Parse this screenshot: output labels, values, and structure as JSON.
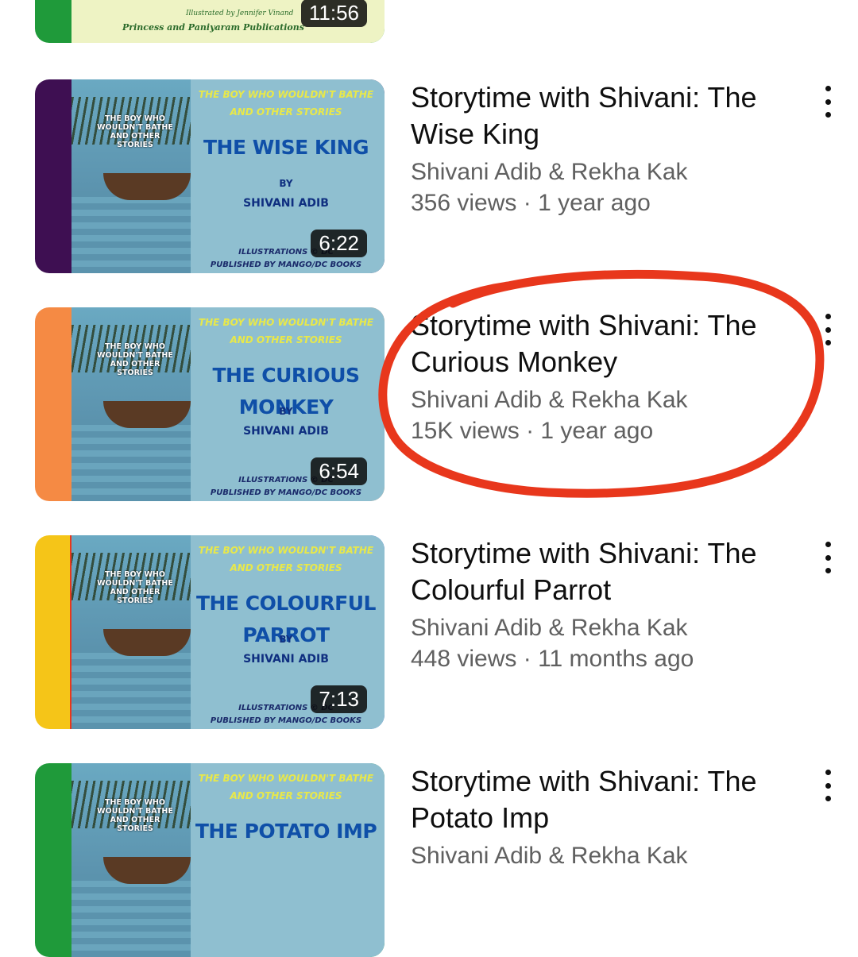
{
  "top_partial": {
    "credit_small": "Illustrated by Jennifer Vinand",
    "publisher": "Princess and Paniyaram Publications",
    "duration": "11:56"
  },
  "videos": [
    {
      "title": "Storytime with Shivani: The Wise King",
      "channel": "Shivani Adib & Rekha Kak",
      "meta": "356 views · 1 year ago",
      "duration": "6:22",
      "thumb": {
        "series": "THE BOY WHO WOULDN'T BATHE AND OTHER STORIES",
        "mini_title": "THE BOY WHO WOULDN'T BATHE AND OTHER STORIES",
        "story": "THE WISE KING",
        "by": "BY",
        "author": "SHIVANI ADIB",
        "illustrations": "ILLUSTRATIONS © DC",
        "published": "PUBLISHED BY MANGO/DC BOOKS",
        "bg": "#3e0f52"
      }
    },
    {
      "title": "Storytime with Shivani: The Curious Monkey",
      "channel": "Shivani Adib & Rekha Kak",
      "meta": "15K views · 1 year ago",
      "duration": "6:54",
      "thumb": {
        "series": "THE BOY WHO WOULDN'T BATHE AND OTHER STORIES",
        "mini_title": "THE BOY WHO WOULDN'T BATHE AND OTHER STORIES",
        "story": "THE CURIOUS MONKEY",
        "by": "BY",
        "author": "SHIVANI ADIB",
        "illustrations": "ILLUSTRATIONS © DC",
        "published": "PUBLISHED BY MANGO/DC BOOKS",
        "bg": "#f58a44"
      }
    },
    {
      "title": "Storytime with Shivani: The Colourful Parrot",
      "channel": "Shivani Adib & Rekha Kak",
      "meta": "448 views · 11 months ago",
      "duration": "7:13",
      "thumb": {
        "series": "THE BOY WHO WOULDN'T BATHE AND OTHER STORIES",
        "mini_title": "THE BOY WHO WOULDN'T BATHE AND OTHER STORIES",
        "story": "THE COLOURFUL PARROT",
        "by": "BY",
        "author": "SHIVANI ADIB",
        "illustrations": "ILLUSTRATIONS © DC",
        "published": "PUBLISHED BY MANGO/DC BOOKS",
        "bg": "#e84a2a"
      }
    },
    {
      "title": "Storytime with Shivani: The Potato Imp",
      "channel": "Shivani Adib & Rekha Kak",
      "meta": "",
      "duration": "",
      "thumb": {
        "series": "THE BOY WHO WOULDN'T BATHE AND OTHER STORIES",
        "mini_title": "THE BOY WHO WOULDN'T BATHE AND OTHER STORIES",
        "story": "THE POTATO IMP",
        "by": "",
        "author": "",
        "illustrations": "",
        "published": "",
        "bg": "#1f9a3a"
      }
    }
  ],
  "icons": {
    "menu": "more-vertical-icon"
  },
  "colors": {
    "title_text": "#0f0f0f",
    "secondary_text": "#606060",
    "highlight_circle": "#e8371c"
  }
}
